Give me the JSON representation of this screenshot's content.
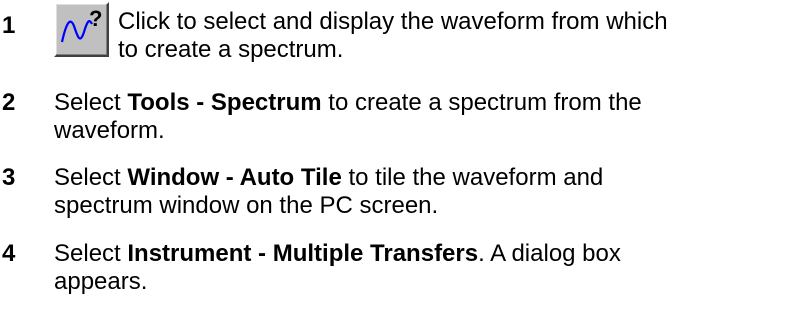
{
  "steps": [
    {
      "number": "1",
      "icon": "waveform-select-help-icon",
      "lines": [
        "Click to select and display the waveform from which",
        "to create a spectrum."
      ]
    },
    {
      "number": "2",
      "pre": "Select ",
      "bold": "Tools - Spectrum",
      "post": " to create a spectrum from the",
      "line2": "waveform."
    },
    {
      "number": "3",
      "pre": "Select ",
      "bold": "Window - Auto Tile",
      "post": " to tile the waveform and",
      "line2": "spectrum window on the PC screen."
    },
    {
      "number": "4",
      "pre": "Select ",
      "bold": "Instrument - Multiple Transfers",
      "post": ". A dialog box",
      "line2": "appears."
    }
  ],
  "colors": {
    "text": "#000000",
    "button_face": "#c0c0c0",
    "icon_wave": "#0000ff",
    "icon_question": "#000000"
  }
}
